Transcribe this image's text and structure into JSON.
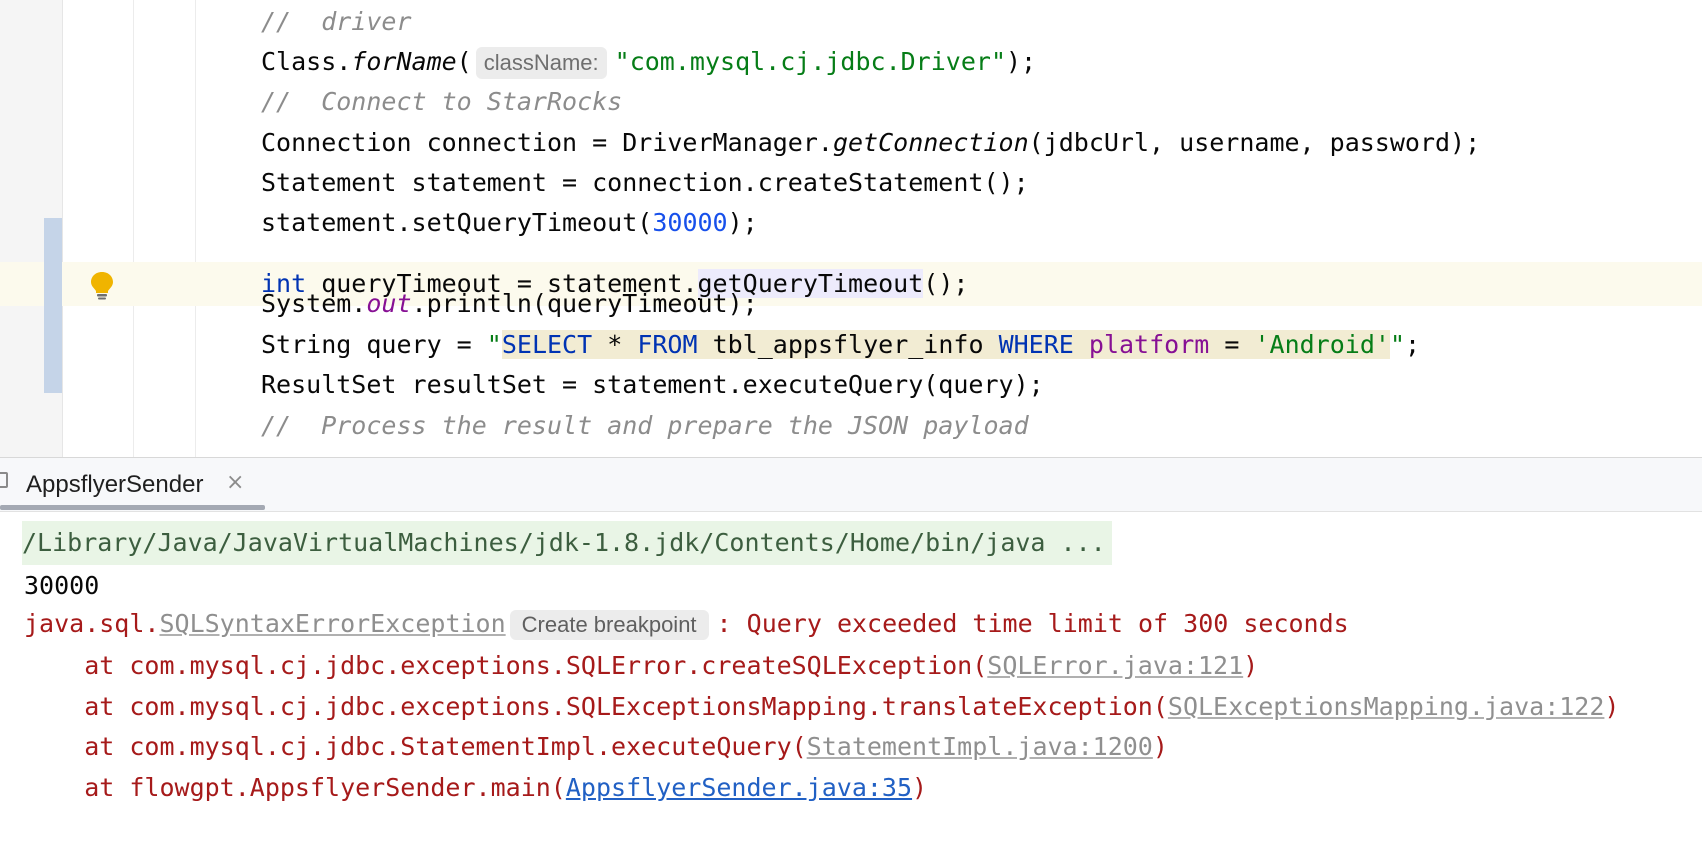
{
  "editor": {
    "lines": {
      "comment_driver": "//  driver",
      "forname_prefix": "Class.",
      "forname_method": "forName",
      "forname_open": "(",
      "forname_hint": "className:",
      "forname_arg": "\"com.mysql.cj.jdbc.Driver\"",
      "forname_close": ");",
      "comment_connect": "//  Connect to StarRocks",
      "conn_prefix": "Connection connection = DriverManager.",
      "conn_method": "getConnection",
      "conn_args": "(jdbcUrl, username, password);",
      "stmt": "Statement statement = connection.createStatement();",
      "timeout_prefix": "statement.setQueryTimeout(",
      "timeout_value": "30000",
      "timeout_close": ");",
      "qt_kw": "int",
      "qt_mid": " queryTimeout = statement.",
      "qt_method": "getQueryTimeout",
      "qt_close": "();",
      "print_prefix": "System.",
      "print_field": "out",
      "print_rest": ".println(queryTimeout);",
      "query_prefix": "String query = ",
      "query_q1": "\"",
      "query_select": "SELECT",
      "query_star": " * ",
      "query_from": "FROM",
      "query_table": " tbl_appsflyer_info ",
      "query_where": "WHERE",
      "query_sp": " ",
      "query_col": "platform",
      "query_eq": " = ",
      "query_val": "'Android'",
      "query_q2": "\"",
      "query_end": ";",
      "result": "ResultSet resultSet = statement.executeQuery(query);",
      "comment_partial": "//  Process the result and prepare the JSON payload"
    },
    "bulb_icon": "lightbulb-icon"
  },
  "run_panel": {
    "tab_label": "AppsflyerSender",
    "tab_close": "×",
    "command": "/Library/Java/JavaVirtualMachines/jdk-1.8.jdk/Contents/Home/bin/java ...",
    "output": "30000",
    "exception": {
      "pkg": "java.sql.",
      "class": "SQLSyntaxErrorException",
      "chip": "Create breakpoint",
      "message": ": Query exceeded time limit of 300 seconds"
    },
    "stack": [
      {
        "prefix": "    at com.mysql.cj.jdbc.exceptions.SQLError.createSQLException(",
        "link": "SQLError.java:121",
        "suffix": ")"
      },
      {
        "prefix": "    at com.mysql.cj.jdbc.exceptions.SQLExceptionsMapping.translateException(",
        "link": "SQLExceptionsMapping.java:122",
        "suffix": ")"
      },
      {
        "prefix": "    at com.mysql.cj.jdbc.StatementImpl.executeQuery(",
        "link": "StatementImpl.java:1200",
        "suffix": ")"
      },
      {
        "prefix": "    at flowgpt.AppsflyerSender.main(",
        "link": "AppsflyerSender.java:35",
        "suffix": ")"
      }
    ]
  },
  "colors": {
    "string": "#067d17",
    "number": "#1750eb",
    "keyword": "#0033b3",
    "error": "#a61a1a",
    "link": "#2160c4"
  }
}
